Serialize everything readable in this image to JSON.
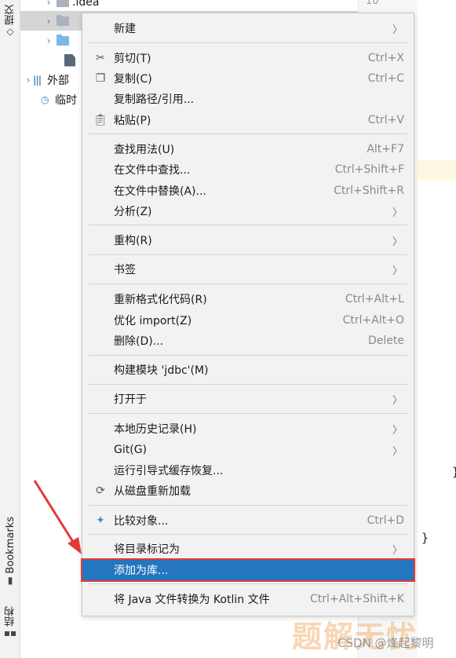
{
  "sidebar": {
    "commit_label": "提交",
    "bookmarks_label": "Bookmarks",
    "structure_label": "结构"
  },
  "tree": {
    "idea_label": ".idea",
    "external_label": "外部",
    "scratch_label": "临时"
  },
  "gutter": {
    "line_number": "10"
  },
  "editor": {
    "brace_1": "}",
    "brace_2": "}"
  },
  "menu": {
    "items": [
      {
        "label": "新建",
        "shortcut": "",
        "submenu": true,
        "icon": ""
      },
      {
        "label": "剪切(T)",
        "shortcut": "Ctrl+X",
        "submenu": false,
        "icon": "scissors-icon"
      },
      {
        "label": "复制(C)",
        "shortcut": "Ctrl+C",
        "submenu": false,
        "icon": "copy-icon"
      },
      {
        "label": "复制路径/引用...",
        "shortcut": "",
        "submenu": false,
        "icon": ""
      },
      {
        "label": "粘贴(P)",
        "shortcut": "Ctrl+V",
        "submenu": false,
        "icon": "paste-icon"
      },
      {
        "label": "查找用法(U)",
        "shortcut": "Alt+F7",
        "submenu": false,
        "icon": ""
      },
      {
        "label": "在文件中查找...",
        "shortcut": "Ctrl+Shift+F",
        "submenu": false,
        "icon": ""
      },
      {
        "label": "在文件中替换(A)...",
        "shortcut": "Ctrl+Shift+R",
        "submenu": false,
        "icon": ""
      },
      {
        "label": "分析(Z)",
        "shortcut": "",
        "submenu": true,
        "icon": ""
      },
      {
        "label": "重构(R)",
        "shortcut": "",
        "submenu": true,
        "icon": ""
      },
      {
        "label": "书签",
        "shortcut": "",
        "submenu": true,
        "icon": ""
      },
      {
        "label": "重新格式化代码(R)",
        "shortcut": "Ctrl+Alt+L",
        "submenu": false,
        "icon": ""
      },
      {
        "label": "优化 import(Z)",
        "shortcut": "Ctrl+Alt+O",
        "submenu": false,
        "icon": ""
      },
      {
        "label": "删除(D)...",
        "shortcut": "Delete",
        "submenu": false,
        "icon": ""
      },
      {
        "label": "构建模块 'jdbc'(M)",
        "shortcut": "",
        "submenu": false,
        "icon": ""
      },
      {
        "label": "打开于",
        "shortcut": "",
        "submenu": true,
        "icon": ""
      },
      {
        "label": "本地历史记录(H)",
        "shortcut": "",
        "submenu": true,
        "icon": ""
      },
      {
        "label": "Git(G)",
        "shortcut": "",
        "submenu": true,
        "icon": ""
      },
      {
        "label": "运行引导式缓存恢复...",
        "shortcut": "",
        "submenu": false,
        "icon": ""
      },
      {
        "label": "从磁盘重新加载",
        "shortcut": "",
        "submenu": false,
        "icon": "reload-icon"
      },
      {
        "label": "比较对象...",
        "shortcut": "Ctrl+D",
        "submenu": false,
        "icon": "compare-icon"
      },
      {
        "label": "将目录标记为",
        "shortcut": "",
        "submenu": true,
        "icon": ""
      },
      {
        "label": "添加为库...",
        "shortcut": "",
        "submenu": false,
        "icon": "",
        "selected": true
      },
      {
        "label": "将 Java 文件转换为 Kotlin 文件",
        "shortcut": "Ctrl+Alt+Shift+K",
        "submenu": false,
        "icon": ""
      }
    ]
  },
  "watermark": {
    "main": "题解无忧",
    "sub": "CSDN @烽起黎明"
  },
  "colors": {
    "selection": "#2675bf",
    "highlight_border": "#e53935",
    "menu_bg": "#f2f2f2"
  }
}
